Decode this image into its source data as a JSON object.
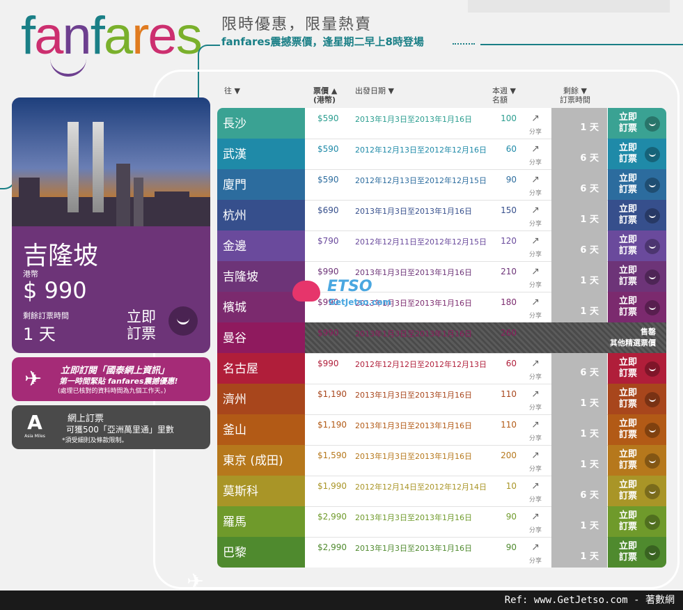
{
  "logo": {
    "text": "fanfares",
    "letters": [
      {
        "ch": "f",
        "color": "#1a7f86"
      },
      {
        "ch": "a",
        "color": "#cc2f6f"
      },
      {
        "ch": "n",
        "color": "#6d3f8f"
      },
      {
        "ch": "f",
        "color": "#1a7f86"
      },
      {
        "ch": "a",
        "color": "#7ab02c"
      },
      {
        "ch": "r",
        "color": "#e07b20"
      },
      {
        "ch": "e",
        "color": "#cc2f6f"
      },
      {
        "ch": "s",
        "color": "#7ab02c"
      }
    ]
  },
  "header": {
    "tagline": "限時優惠，限量熱賣",
    "subline": "fanfares震撼票價，逢星期二早上8時登場"
  },
  "columns": {
    "dest": "往 ▼",
    "price": "票價 ▲",
    "price_unit": "(港幣)",
    "date": "出發日期 ▼",
    "qty": "本週 ▼",
    "qty2": "名額",
    "remain": "剩餘 ▼",
    "remain2": "訂票時間"
  },
  "feature": {
    "city": "吉隆坡",
    "currency": "港幣",
    "price": "$ 990",
    "remaining_label": "剩餘訂票時間",
    "days": "1 天",
    "book": "立即",
    "book2": "訂票"
  },
  "promo": {
    "line1": "立即訂閱「國泰網上資訊」",
    "line2": "第一時間緊貼 fanfares震撼優惠!",
    "line3": "(處理已核對的資料時間為九個工作天。)"
  },
  "asia": {
    "logo": "A",
    "logo_text": "Asia Miles",
    "line1": "網上訂票",
    "line2": "可獲500「亞洲萬里通」里數",
    "line3": "*須受細則及條款限制。"
  },
  "share_label": "分享",
  "share_icon": "↗",
  "book_label_1": "立即",
  "book_label_2": "訂票",
  "rows": [
    {
      "city": "長沙",
      "price": "$590",
      "date": "2013年1月3日至2013年1月16日",
      "qty": "100",
      "days": "1 天",
      "color": "#3aa293",
      "btn": "#3aa293",
      "pcolor": "#2a9d8f"
    },
    {
      "city": "武漢",
      "price": "$590",
      "date": "2012年12月13日至2012年12月16日",
      "qty": "60",
      "days": "6 天",
      "color": "#1f8aa8",
      "btn": "#1f8aa8",
      "pcolor": "#1f8aa8"
    },
    {
      "city": "廈門",
      "price": "$590",
      "date": "2012年12月13日至2012年12月15日",
      "qty": "90",
      "days": "6 天",
      "color": "#2c6c9e",
      "btn": "#2c6c9e",
      "pcolor": "#2c6c9e"
    },
    {
      "city": "杭州",
      "price": "$690",
      "date": "2013年1月3日至2013年1月16日",
      "qty": "150",
      "days": "1 天",
      "color": "#364f8c",
      "btn": "#364f8c",
      "pcolor": "#364f8c"
    },
    {
      "city": "金邊",
      "price": "$790",
      "date": "2012年12月11日至2012年12月15日",
      "qty": "120",
      "days": "6 天",
      "color": "#6a4a9c",
      "btn": "#6a4a9c",
      "pcolor": "#6a4a9c"
    },
    {
      "city": "吉隆坡",
      "price": "$990",
      "date": "2013年1月3日至2013年1月16日",
      "qty": "210",
      "days": "1 天",
      "color": "#6d3478",
      "btn": "#6d3478",
      "pcolor": "#6d3478"
    },
    {
      "city": "檳城",
      "price": "$990",
      "date": "2013年1月3日至2013年1月16日",
      "qty": "180",
      "days": "1 天",
      "color": "#7b2a6e",
      "btn": "#7b2a6e",
      "pcolor": "#7b2a6e"
    },
    {
      "city": "曼谷",
      "price": "$990",
      "date": "2013年1月3日至2013年1月16日",
      "qty": "260",
      "sold": true,
      "sold1": "售罄",
      "sold2": "其他精選票價",
      "color": "#8f1a5e",
      "btn": "#8f1a5e",
      "pcolor": "#8f1a5e"
    },
    {
      "city": "名古屋",
      "price": "$990",
      "date": "2012年12月12日至2012年12月13日",
      "qty": "60",
      "days": "6 天",
      "color": "#b01e3a",
      "btn": "#b01e3a",
      "pcolor": "#b01e3a"
    },
    {
      "city": "濟州",
      "price": "$1,190",
      "date": "2013年1月3日至2013年1月16日",
      "qty": "110",
      "days": "1 天",
      "color": "#a8461c",
      "btn": "#a8461c",
      "pcolor": "#a8461c"
    },
    {
      "city": "釜山",
      "price": "$1,190",
      "date": "2013年1月3日至2013年1月16日",
      "qty": "110",
      "days": "1 天",
      "color": "#b25a16",
      "btn": "#b25a16",
      "pcolor": "#b25a16"
    },
    {
      "city": "東京 (成田)",
      "price": "$1,590",
      "date": "2013年1月3日至2013年1月16日",
      "qty": "200",
      "days": "1 天",
      "color": "#b6781c",
      "btn": "#b6781c",
      "pcolor": "#b6781c"
    },
    {
      "city": "莫斯科",
      "price": "$1,990",
      "date": "2012年12月14日至2012年12月14日",
      "qty": "10",
      "days": "6 天",
      "color": "#a99527",
      "btn": "#a99527",
      "pcolor": "#a99527"
    },
    {
      "city": "羅馬",
      "price": "$2,990",
      "date": "2013年1月3日至2013年1月16日",
      "qty": "90",
      "days": "1 天",
      "color": "#6f9a2b",
      "btn": "#6f9a2b",
      "pcolor": "#6f9a2b"
    },
    {
      "city": "巴黎",
      "price": "$2,990",
      "date": "2013年1月3日至2013年1月16日",
      "qty": "90",
      "days": "1 天",
      "color": "#4f8a2e",
      "btn": "#4f8a2e",
      "pcolor": "#4f8a2e"
    }
  ],
  "watermark": {
    "t": "ETSO",
    "u": "GetJetso.com"
  },
  "footer": "Ref: www.GetJetso.com - 著數網"
}
